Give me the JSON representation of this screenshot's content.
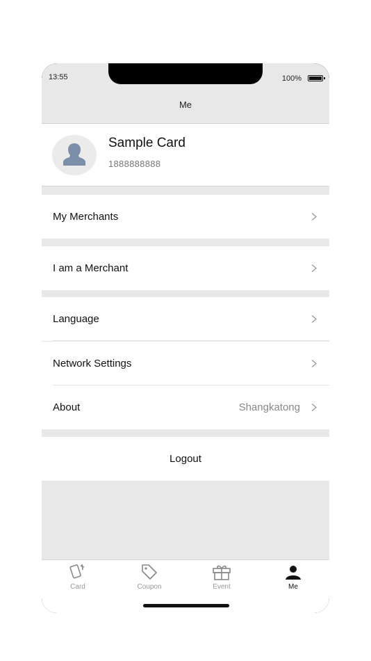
{
  "status": {
    "time": "13:55",
    "battery": "100%"
  },
  "header": {
    "title": "Me"
  },
  "profile": {
    "card_name": "Sample Card",
    "phone": "1888888888"
  },
  "menu": [
    {
      "label": "My Merchants",
      "value": ""
    },
    {
      "label": "I am a Merchant",
      "value": ""
    },
    {
      "label": "Language",
      "value": ""
    },
    {
      "label": "Network Settings",
      "value": ""
    },
    {
      "label": "About",
      "value": "Shangkatong"
    }
  ],
  "logout": {
    "label": "Logout"
  },
  "tabs": [
    {
      "label": "Card",
      "icon": "card-icon",
      "active": false
    },
    {
      "label": "Coupon",
      "icon": "coupon-icon",
      "active": false
    },
    {
      "label": "Event",
      "icon": "gift-icon",
      "active": false
    },
    {
      "label": "Me",
      "icon": "person-icon",
      "active": true
    }
  ],
  "colors": {
    "background": "#e8e8e8",
    "surface": "#ffffff",
    "muted_text": "#888888"
  }
}
